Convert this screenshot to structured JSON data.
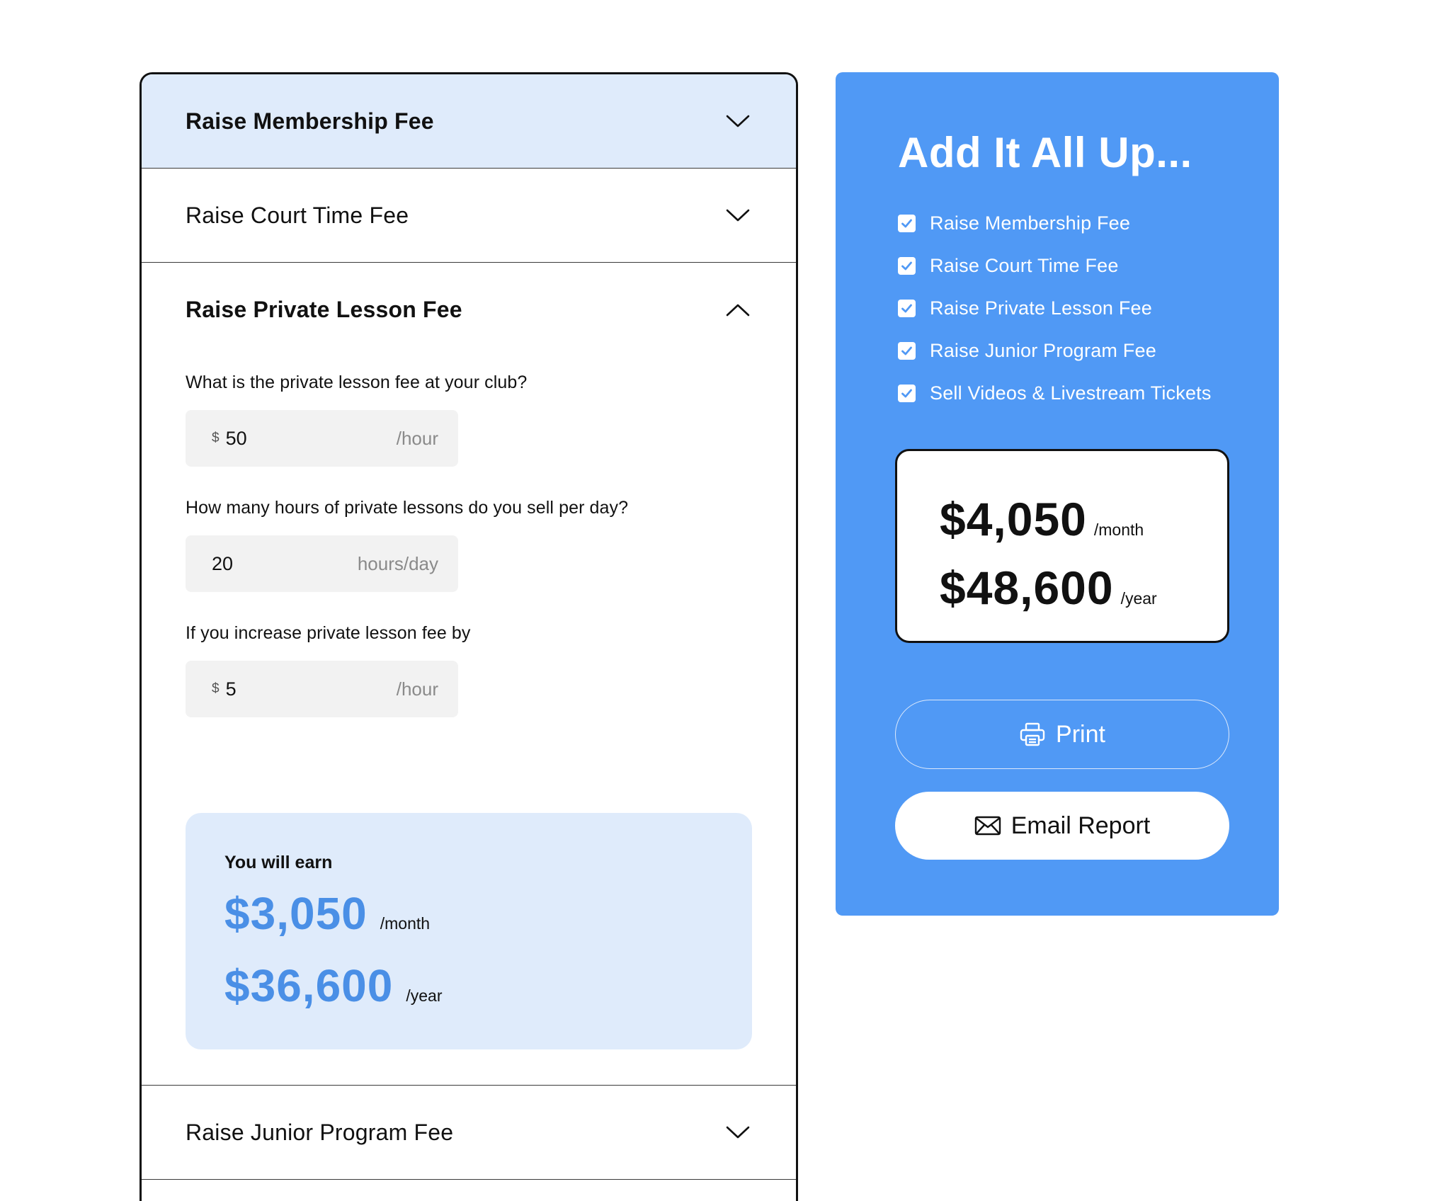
{
  "accordion": {
    "sections": [
      {
        "title": "Raise Membership Fee",
        "state": "collapsed",
        "highlighted": true
      },
      {
        "title": "Raise Court Time Fee",
        "state": "collapsed"
      },
      {
        "title": "Raise Private Lesson Fee",
        "state": "expanded"
      },
      {
        "title": "Raise Junior Program Fee",
        "state": "collapsed"
      }
    ],
    "private_lesson": {
      "q1_label": "What is the private lesson fee at your club?",
      "q1_currency": "$",
      "q1_value": "50",
      "q1_unit": "/hour",
      "q2_label": "How many hours of private lessons do you sell per day?",
      "q2_value": "20",
      "q2_unit": "hours/day",
      "q3_label": "If you increase private lesson fee by",
      "q3_currency": "$",
      "q3_value": "5",
      "q3_unit": "/hour",
      "earn": {
        "label": "You will earn",
        "monthly": "$3,050",
        "monthly_unit": "/month",
        "yearly": "$36,600",
        "yearly_unit": "/year"
      }
    }
  },
  "summary": {
    "title": "Add It All Up...",
    "items": [
      {
        "label": "Raise Membership Fee",
        "checked": true
      },
      {
        "label": "Raise Court Time Fee",
        "checked": true
      },
      {
        "label": "Raise Private Lesson Fee",
        "checked": true
      },
      {
        "label": "Raise Junior Program Fee",
        "checked": true
      },
      {
        "label": "Sell Videos & Livestream Tickets",
        "checked": true
      }
    ],
    "total_monthly": "$4,050",
    "total_monthly_unit": "/month",
    "total_yearly": "$48,600",
    "total_yearly_unit": "/year",
    "print_label": "Print",
    "email_label": "Email Report"
  },
  "colors": {
    "accent_blue": "#5099f5",
    "light_blue": "#dfebfb",
    "earn_blue": "#4a8fe6",
    "field_bg": "#f2f2f2"
  },
  "icons": [
    "chevron-down-icon",
    "chevron-up-icon",
    "checkbox-checked-icon",
    "printer-icon",
    "envelope-icon"
  ]
}
